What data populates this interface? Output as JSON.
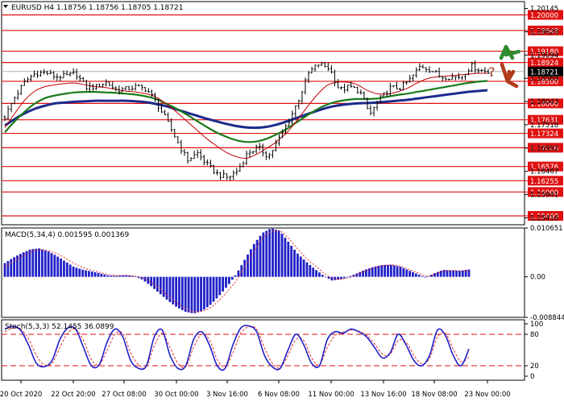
{
  "chart_data": [
    {
      "type": "candlestick",
      "symbol": "EURUSD",
      "timeframe": "H4",
      "ohlc_header": {
        "title": "EURUSD, H4",
        "open": "1.18756",
        "high": "1.18756",
        "low": "1.18705",
        "close": "1.18721"
      },
      "y_ticks": [
        "1.20145",
        "1.19620",
        "1.19094",
        "1.18569",
        "1.18043",
        "1.17518",
        "1.16992",
        "1.16467",
        "1.15941",
        "1.15416"
      ],
      "ylim": [
        1.1526,
        1.203
      ],
      "level_labels": [
        "1.20000",
        "1.19648",
        "1.19180",
        "1.18924",
        "1.18500",
        "1.18000",
        "1.17631",
        "1.17324",
        "1.17000",
        "1.16576",
        "1.16255",
        "1.16000",
        "1.15460"
      ],
      "current_price": "1.18721",
      "x_tick_labels": [
        "20 Oct 2020",
        "22 Oct 20:00",
        "27 Oct 08:00",
        "30 Oct 00:00",
        "3 Nov 16:00",
        "6 Nov 08:00",
        "11 Nov 00:00",
        "13 Nov 16:00",
        "18 Nov 08:00",
        "23 Nov 00:00"
      ],
      "close_path": [
        1.177,
        1.1815,
        1.185,
        1.1868,
        1.187,
        1.186,
        1.1862,
        1.1868,
        1.1836,
        1.1838,
        1.1848,
        1.183,
        1.1833,
        1.1838,
        1.1832,
        1.18,
        1.176,
        1.1715,
        1.1672,
        1.1688,
        1.166,
        1.164,
        1.1632,
        1.165,
        1.169,
        1.17,
        1.168,
        1.1718,
        1.176,
        1.181,
        1.187,
        1.189,
        1.188,
        1.183,
        1.1838,
        1.1828,
        1.1775,
        1.181,
        1.1835,
        1.1835,
        1.1855,
        1.1885,
        1.1876,
        1.186,
        1.186,
        1.186,
        1.1885,
        1.1875,
        1.1868
      ],
      "series": [
        {
          "name": "MA fast",
          "color": "#c00000",
          "values": [
            1.1745,
            1.1778,
            1.1808,
            1.1828,
            1.1838,
            1.1842,
            1.1845,
            1.1846,
            1.1842,
            1.1838,
            1.1836,
            1.1832,
            1.1828,
            1.1826,
            1.1822,
            1.1815,
            1.18,
            1.1782,
            1.1762,
            1.1742,
            1.1722,
            1.1705,
            1.169,
            1.168,
            1.1676,
            1.1685,
            1.1698,
            1.1713,
            1.1733,
            1.176,
            1.179,
            1.1818,
            1.184,
            1.1848,
            1.1848,
            1.1843,
            1.183,
            1.1822,
            1.1821,
            1.1826,
            1.1834,
            1.1846,
            1.1856,
            1.186,
            1.1862,
            1.1864,
            1.1866,
            1.1868,
            1.1868
          ]
        },
        {
          "name": "MA medium",
          "color": "#1a7a1a",
          "values": [
            1.1735,
            1.176,
            1.1782,
            1.18,
            1.1812,
            1.1818,
            1.1822,
            1.1825,
            1.1826,
            1.1826,
            1.1825,
            1.1824,
            1.1822,
            1.182,
            1.1816,
            1.181,
            1.18,
            1.1789,
            1.1776,
            1.1762,
            1.1748,
            1.1735,
            1.1725,
            1.1717,
            1.1713,
            1.1714,
            1.172,
            1.173,
            1.1742,
            1.1757,
            1.1772,
            1.1786,
            1.1797,
            1.1804,
            1.1808,
            1.181,
            1.181,
            1.1811,
            1.1815,
            1.1819,
            1.1822,
            1.1826,
            1.183,
            1.1834,
            1.1838,
            1.1842,
            1.1846,
            1.1849,
            1.1851
          ]
        },
        {
          "name": "MA slow",
          "color": "#1c2a8c",
          "values": [
            1.175,
            1.1765,
            1.1778,
            1.1788,
            1.1795,
            1.18,
            1.1802,
            1.1804,
            1.1805,
            1.1806,
            1.1806,
            1.1806,
            1.1806,
            1.1805,
            1.1803,
            1.1799,
            1.1794,
            1.1787,
            1.178,
            1.1773,
            1.1766,
            1.176,
            1.1754,
            1.1749,
            1.1746,
            1.1745,
            1.1747,
            1.1752,
            1.1759,
            1.1767,
            1.1775,
            1.1783,
            1.179,
            1.1795,
            1.1798,
            1.18,
            1.1801,
            1.1802,
            1.1804,
            1.1806,
            1.1808,
            1.1811,
            1.1814,
            1.1817,
            1.182,
            1.1823,
            1.1826,
            1.1828,
            1.183
          ]
        }
      ],
      "forecast_arrows": [
        {
          "direction": "up",
          "color": "#2e8b2e"
        },
        {
          "direction": "down",
          "color": "#b03a1a",
          "label": "?"
        }
      ]
    },
    {
      "type": "bar",
      "title": "MACD(5,34,4) 0.001595 0.001369",
      "y_ticks": [
        "0.010651",
        "0.00",
        "-0.008844"
      ],
      "ylim": [
        -0.008844,
        0.010651
      ],
      "bar_color": "#2020c8",
      "signal_color": "#e03030",
      "values": [
        0.003,
        0.0042,
        0.0052,
        0.006,
        0.0062,
        0.0056,
        0.0046,
        0.0034,
        0.0022,
        0.0016,
        0.0012,
        0.0008,
        0.0003,
        0.0002,
        0.0004,
        0.0002,
        -0.0006,
        -0.002,
        -0.0036,
        -0.0052,
        -0.0066,
        -0.0076,
        -0.008,
        -0.0074,
        -0.006,
        -0.004,
        -0.0018,
        0.0008,
        0.004,
        0.0072,
        0.0096,
        0.0106,
        0.01,
        0.0076,
        0.0052,
        0.0034,
        0.0018,
        0.0004,
        -0.0008,
        -0.0006,
        0.0,
        0.0008,
        0.0016,
        0.0022,
        0.0026,
        0.0026,
        0.0022,
        0.0014,
        0.0006,
        -0.0002,
        0.0008,
        0.0015,
        0.0014,
        0.0013,
        0.0016
      ],
      "signal": [
        0.0022,
        0.0034,
        0.0045,
        0.0054,
        0.0059,
        0.0057,
        0.0051,
        0.0041,
        0.003,
        0.0021,
        0.0015,
        0.001,
        0.0005,
        0.0003,
        0.0003,
        0.0002,
        -0.0002,
        -0.0012,
        -0.0026,
        -0.0042,
        -0.0057,
        -0.0069,
        -0.0076,
        -0.0075,
        -0.0066,
        -0.005,
        -0.003,
        -0.0006,
        0.0024,
        0.0056,
        0.0084,
        0.0099,
        0.01,
        0.0084,
        0.0062,
        0.0042,
        0.0026,
        0.001,
        -0.0002,
        -0.0005,
        -0.0002,
        0.0005,
        0.0013,
        0.0019,
        0.0024,
        0.0026,
        0.0023,
        0.0016,
        0.0009,
        0.0002,
        0.0005,
        0.0012,
        0.0014,
        0.0013,
        0.0014
      ]
    },
    {
      "type": "line",
      "title": "Stoch(5,3,3) 52.1455 36.0899",
      "y_ticks": [
        "100",
        "80",
        "20",
        "0"
      ],
      "ylim": [
        0,
        100
      ],
      "levels": [
        80,
        20
      ],
      "series": [
        {
          "name": "%K",
          "color": "#2020c8",
          "values": [
            90,
            95,
            88,
            60,
            25,
            18,
            30,
            70,
            92,
            90,
            55,
            20,
            22,
            65,
            90,
            75,
            30,
            15,
            20,
            75,
            88,
            40,
            15,
            20,
            70,
            85,
            60,
            20,
            15,
            60,
            92,
            96,
            85,
            40,
            18,
            15,
            50,
            80,
            60,
            25,
            20,
            70,
            85,
            82,
            90,
            85,
            75,
            55,
            35,
            45,
            80,
            60,
            30,
            20,
            40,
            88,
            78,
            40,
            20,
            52
          ]
        },
        {
          "name": "%D",
          "color": "#e03030",
          "values": [
            85,
            92,
            90,
            72,
            40,
            22,
            25,
            55,
            82,
            90,
            68,
            32,
            22,
            50,
            80,
            82,
            45,
            22,
            18,
            58,
            82,
            55,
            25,
            18,
            55,
            80,
            70,
            32,
            18,
            45,
            82,
            94,
            90,
            55,
            25,
            16,
            40,
            70,
            68,
            35,
            22,
            55,
            78,
            84,
            88,
            86,
            78,
            62,
            42,
            42,
            68,
            65,
            40,
            24,
            34,
            75,
            82,
            52,
            28,
            36
          ]
        }
      ]
    }
  ]
}
